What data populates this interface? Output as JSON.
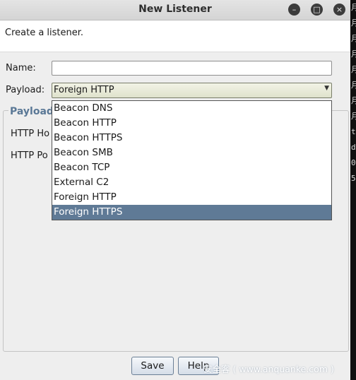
{
  "window": {
    "title": "New Listener",
    "minimize_glyph": "–",
    "maximize_glyph": "□",
    "close_glyph": "×"
  },
  "banner": {
    "text": "Create a listener."
  },
  "form": {
    "name_label": "Name:",
    "name_value": "",
    "payload_label": "Payload:",
    "payload_value": "Foreign HTTP",
    "payload_arrow": "▼",
    "payload_options": [
      "Beacon DNS",
      "Beacon HTTP",
      "Beacon HTTPS",
      "Beacon SMB",
      "Beacon TCP",
      "External C2",
      "Foreign HTTP",
      "Foreign HTTPS"
    ],
    "highlighted_option": "Foreign HTTPS"
  },
  "payload_group": {
    "title": "Payload",
    "host_label": "HTTP Ho",
    "port_label": "HTTP Po"
  },
  "buttons": {
    "save": "Save",
    "help": "Help"
  },
  "watermark": "安全客 ( www.anquanke.com )",
  "terminal_chars": [
    "月",
    "月",
    "月",
    "月",
    "月",
    "月",
    "月",
    "月",
    "t",
    "d",
    "0",
    "5"
  ],
  "colors": {
    "highlight": "#5f7a96",
    "group_title": "#5a7896"
  }
}
